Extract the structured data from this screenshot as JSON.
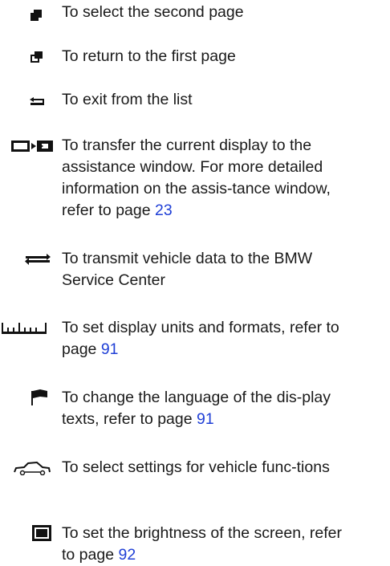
{
  "items": [
    {
      "icon": "second-page-icon",
      "text": "To select the second page"
    },
    {
      "icon": "first-page-icon",
      "text": "To return to the first page"
    },
    {
      "icon": "exit-arrow-icon",
      "text": "To exit from the list"
    },
    {
      "icon": "transfer-display-icon",
      "text": "To transfer the current display to the assistance window. For more detailed information on the assis-tance window, refer to page ",
      "page": "23"
    },
    {
      "icon": "transmit-data-icon",
      "text": "To transmit vehicle data to the BMW Service Center"
    },
    {
      "icon": "ruler-icon",
      "text": "To set display units and formats, refer to page ",
      "page": "91"
    },
    {
      "icon": "flag-icon",
      "text": "To change the language of the dis-play texts, refer to page ",
      "page": "91"
    },
    {
      "icon": "car-icon",
      "text": "To select settings for vehicle func-tions"
    },
    {
      "icon": "screen-icon",
      "text": "To set the brightness of the screen, refer to page ",
      "page": "92"
    }
  ]
}
